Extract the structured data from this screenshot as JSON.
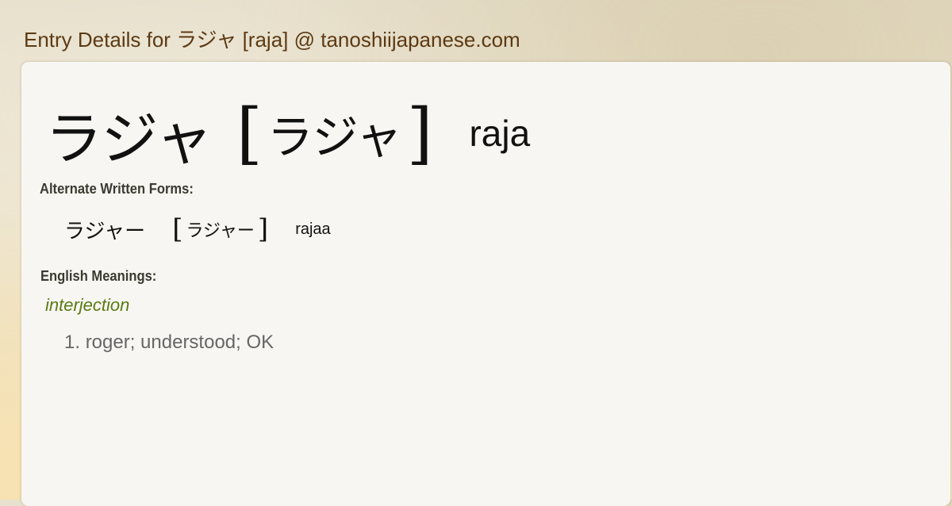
{
  "page": {
    "title": "Entry Details for ラジャ [raja] @ tanoshiijapanese.com"
  },
  "entry": {
    "word": "ラジャ",
    "bracket_open": "[",
    "reading": "ラジャ",
    "bracket_close": "]",
    "romaji": "raja"
  },
  "alternate_forms": {
    "label": "Alternate Written Forms:",
    "items": [
      {
        "word": "ラジャー",
        "bracket_open": "[",
        "reading": "ラジャー",
        "bracket_close": "]",
        "romaji": "rajaa"
      }
    ]
  },
  "meanings": {
    "label": "English Meanings:",
    "part_of_speech": "interjection",
    "items": [
      {
        "number": "1.",
        "text": "roger; understood; OK"
      }
    ]
  },
  "colors": {
    "title": "#5c3a14",
    "part_of_speech": "#5a7a12",
    "meaning_text": "#666666",
    "card_background": "#f7f6f2"
  }
}
